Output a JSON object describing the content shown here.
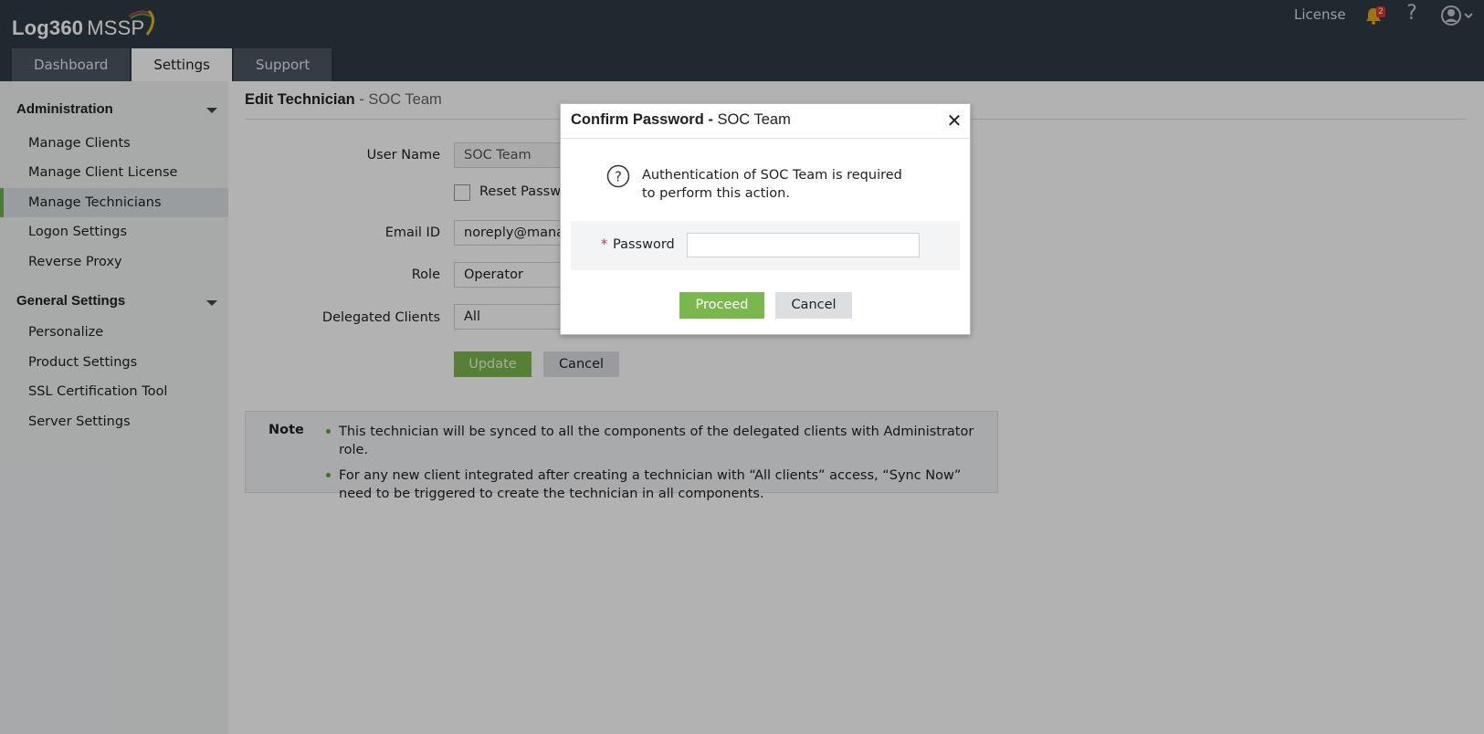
{
  "header": {
    "logo_product": "Log360",
    "logo_suffix": "MSSP",
    "tabs": [
      {
        "label": "Dashboard"
      },
      {
        "label": "Settings"
      },
      {
        "label": "Support"
      }
    ],
    "license_label": "License",
    "notification_count": "2",
    "help_label": "?",
    "icons": {
      "bell": "bell-icon",
      "help": "help-icon",
      "user": "user-avatar-icon"
    }
  },
  "sidebar": {
    "sections": [
      {
        "title": "Administration",
        "items": [
          {
            "label": "Manage Clients"
          },
          {
            "label": "Manage Client License"
          },
          {
            "label": "Manage Technicians"
          },
          {
            "label": "Logon Settings"
          },
          {
            "label": "Reverse Proxy"
          }
        ]
      },
      {
        "title": "General Settings",
        "items": [
          {
            "label": "Personalize"
          },
          {
            "label": "Product Settings"
          },
          {
            "label": "SSL Certification Tool"
          },
          {
            "label": "Server Settings"
          }
        ]
      }
    ],
    "active_item": "Manage Technicians"
  },
  "main": {
    "title_bold": "Edit Technician",
    "title_sub": "- SOC Team",
    "form": {
      "user_name_label": "User Name",
      "user_name_value": "SOC Team",
      "reset_password_label": "Reset Passwo",
      "email_label": "Email ID",
      "email_value": "noreply@mana",
      "role_label": "Role",
      "role_value": "Operator",
      "delegated_label": "Delegated Clients",
      "delegated_value": "All",
      "update_label": "Update",
      "cancel_label": "Cancel"
    },
    "note": {
      "title": "Note",
      "items": [
        "This technician will be synced to all the components of the delegated clients with Administrator role.",
        "For any new client integrated after creating a technician with “All clients” access, “Sync Now” need to be triggered to create the technician in all components."
      ]
    }
  },
  "modal": {
    "title_bold": "Confirm Password -",
    "title_sub": "SOC Team",
    "close_icon": "close-icon",
    "message": "Authentication of SOC Team is required to perform this action.",
    "required_mark": "*",
    "password_label": "Password",
    "password_value": "",
    "proceed_label": "Proceed",
    "cancel_label": "Cancel"
  },
  "colors": {
    "header_bg": "#2f3b45",
    "accent_green": "#7ab84e",
    "sidebar_bg": "#f1f2f3",
    "badge_red": "#e0352b"
  }
}
